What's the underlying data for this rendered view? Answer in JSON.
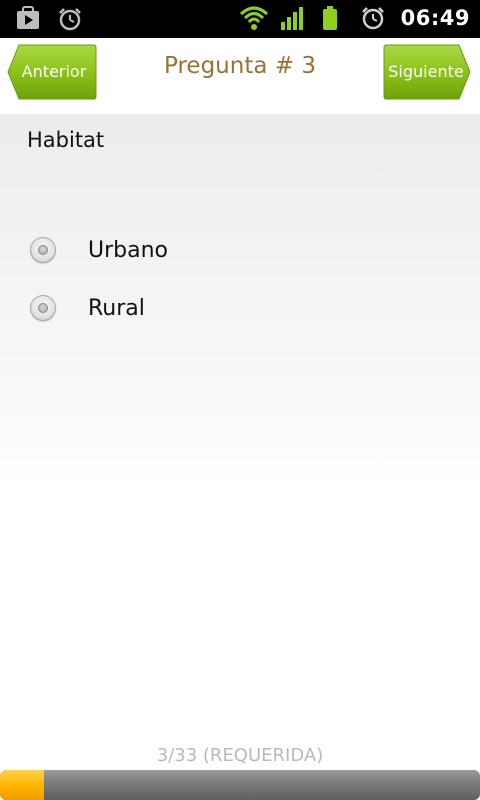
{
  "status_bar": {
    "time": "06:49",
    "icons": [
      "play-store-notification-icon",
      "alarm-notification-icon",
      "wifi-icon",
      "signal-icon",
      "battery-icon",
      "alarm-icon"
    ],
    "colors": {
      "wifi": "#8ecf1f",
      "signal": "#8ecf1f",
      "battery": "#8ecf1f"
    }
  },
  "header": {
    "prev_label": "Anterior",
    "next_label": "Siguiente",
    "title": "Pregunta # 3",
    "button_color": "#8cc31a",
    "title_color": "#9a7235"
  },
  "question": {
    "label": "Habitat",
    "options": [
      {
        "label": "Urbano",
        "selected": false
      },
      {
        "label": "Rural",
        "selected": false
      }
    ]
  },
  "progress": {
    "text": "3/33 (REQUERIDA)",
    "current": 3,
    "total": 33,
    "fill_color": "#ffb600"
  }
}
